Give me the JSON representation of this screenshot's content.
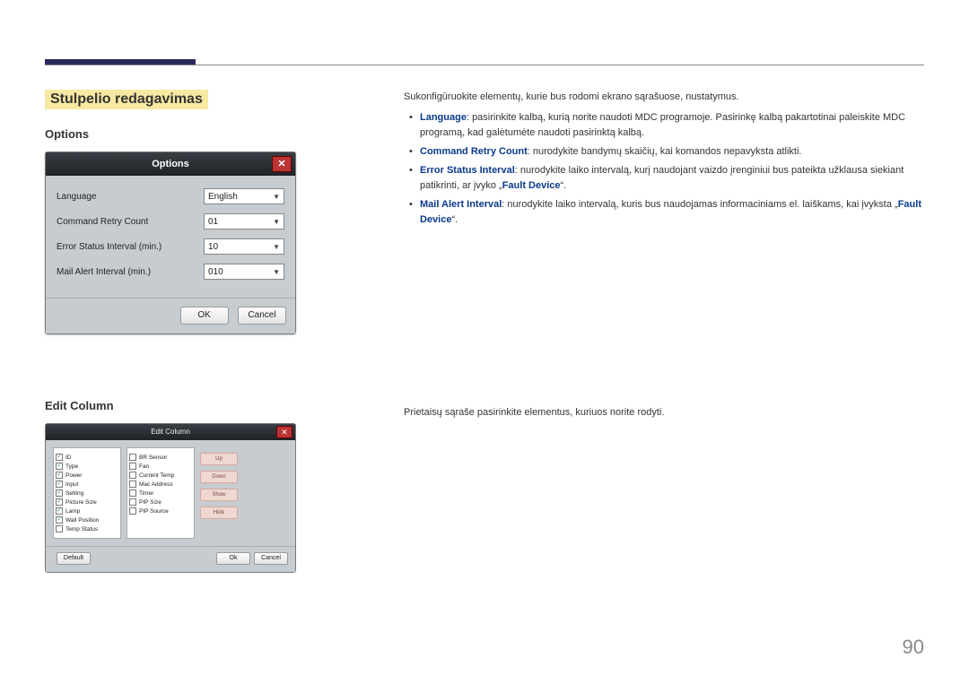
{
  "page": {
    "title": "Stulpelio redagavimas",
    "number": "90"
  },
  "options_section": {
    "heading": "Options",
    "dialog": {
      "title": "Options",
      "close": "✕",
      "fields": {
        "language": {
          "label": "Language",
          "value": "English"
        },
        "retry": {
          "label": "Command Retry Count",
          "value": "01"
        },
        "error_interval": {
          "label": "Error Status Interval (min.)",
          "value": "10"
        },
        "mail_interval": {
          "label": "Mail Alert Interval (min.)",
          "value": "010"
        }
      },
      "ok": "OK",
      "cancel": "Cancel"
    },
    "desc_lead": "Sukonfigūruokite elementų, kurie bus rodomi ekrano sąrašuose, nustatymus.",
    "bullets": {
      "b1_label": "Language",
      "b1_text": ": pasirinkite kalbą, kurią norite naudoti MDC programoje. Pasirinkę kalbą pakartotinai paleiskite MDC programą, kad galėtumėte naudoti pasirinktą kalbą.",
      "b2_label": "Command Retry Count",
      "b2_text": ": nurodykite bandymų skaičių, kai komandos nepavyksta atlikti.",
      "b3_label": "Error Status Interval",
      "b3_text_a": ": nurodykite laiko intervalą, kurį naudojant vaizdo įrenginiui bus pateikta užklausa siekiant patikrinti, ar įvyko „",
      "b3_fault": "Fault Device",
      "b3_text_b": "“.",
      "b4_label": "Mail Alert Interval",
      "b4_text_a": ": nurodykite laiko intervalą, kuris bus naudojamas informaciniams el. laiškams, kai įvyksta „",
      "b4_fault": "Fault Device",
      "b4_text_b": "“."
    }
  },
  "edit_section": {
    "heading": "Edit Column",
    "desc": "Prietaisų sąraše pasirinkite elementus, kuriuos norite rodyti.",
    "dialog": {
      "title": "Edit Column",
      "close": "✕",
      "col1": [
        {
          "label": "ID",
          "checked": true
        },
        {
          "label": "Type",
          "checked": true
        },
        {
          "label": "Power",
          "checked": true
        },
        {
          "label": "Input",
          "checked": true
        },
        {
          "label": "Setting",
          "checked": true
        },
        {
          "label": "Picture Size",
          "checked": true
        },
        {
          "label": "Lamp",
          "checked": true
        },
        {
          "label": "Wall Position",
          "checked": true
        },
        {
          "label": "Temp Status",
          "checked": false
        }
      ],
      "col2": [
        {
          "label": "BR Sensor",
          "checked": false
        },
        {
          "label": "Fan",
          "checked": false
        },
        {
          "label": "Current Temp",
          "checked": false
        },
        {
          "label": "Mac Address",
          "checked": false
        },
        {
          "label": "Timer",
          "checked": false
        },
        {
          "label": "PIP Size",
          "checked": false
        },
        {
          "label": "PIP Source",
          "checked": false
        }
      ],
      "side": {
        "up": "Up",
        "down": "Down",
        "show": "Show",
        "hide": "Hide"
      },
      "default": "Default",
      "ok": "Ok",
      "cancel": "Cancel"
    }
  }
}
